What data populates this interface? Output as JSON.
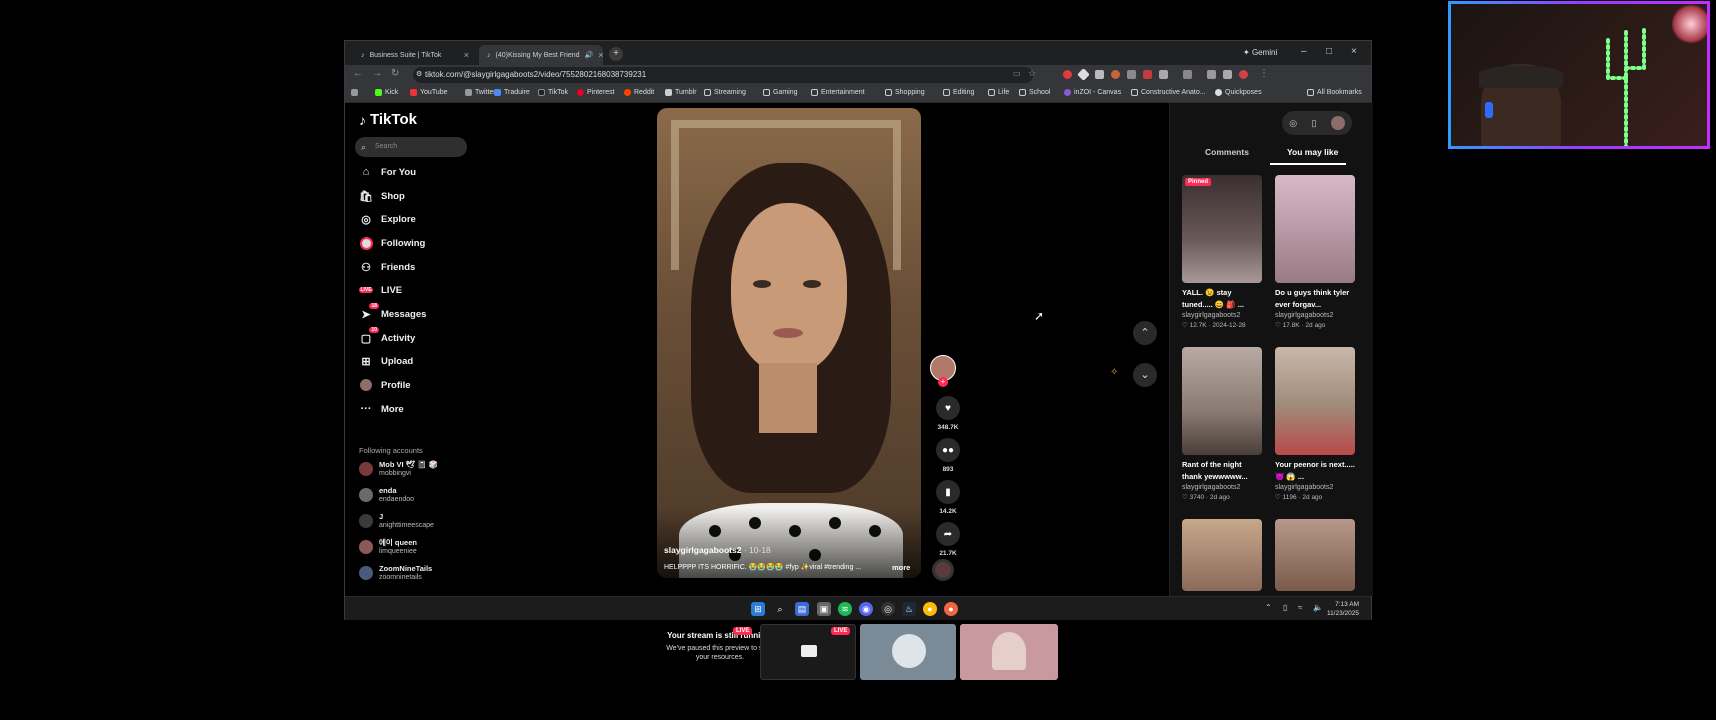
{
  "browser": {
    "tabs": [
      {
        "label": "Business Suite | TikTok",
        "active": false
      },
      {
        "label": "(40)Kissing My Best Friend",
        "active": true
      }
    ],
    "gemini_label": "Gemini",
    "url": "tiktok.com/@slaygirlgagaboots2/video/7552802168038739231",
    "bookmarks": [
      "Kick",
      "YouTube",
      "Twitter",
      "Traduire",
      "TikTok",
      "Pinterest",
      "Reddit",
      "Tumblr",
      "Streaming",
      "Gaming",
      "Entertainment",
      "Shopping",
      "Editing",
      "Life",
      "School",
      "inZOI - Canvas",
      "Constructive Anato...",
      "Quickposes"
    ],
    "all_bookmarks": "All Bookmarks"
  },
  "tiktok": {
    "logo": "TikTok",
    "search_placeholder": "Search",
    "nav": [
      {
        "label": "For You",
        "icon": "home-icon"
      },
      {
        "label": "Shop",
        "icon": "shop-icon"
      },
      {
        "label": "Explore",
        "icon": "explore-icon"
      },
      {
        "label": "Following",
        "icon": "following-icon"
      },
      {
        "label": "Friends",
        "icon": "friends-icon"
      },
      {
        "label": "LIVE",
        "icon": "live-icon"
      },
      {
        "label": "Messages",
        "icon": "messages-icon",
        "badge": "18"
      },
      {
        "label": "Activity",
        "icon": "activity-icon",
        "badge": "10"
      },
      {
        "label": "Upload",
        "icon": "upload-icon"
      },
      {
        "label": "Profile",
        "icon": "profile-icon"
      },
      {
        "label": "More",
        "icon": "more-icon"
      }
    ],
    "following_title": "Following accounts",
    "following": [
      {
        "name": "Mob VI 🕊 📓 🎲",
        "handle": "mobbingvi",
        "color": "#7a3a3a"
      },
      {
        "name": "enda",
        "handle": "endaendoo",
        "color": "#6a6a6a"
      },
      {
        "name": "J",
        "handle": "anighttimeescape",
        "color": "#3a3a3a"
      },
      {
        "name": "에이 queen",
        "handle": "limqueeniee",
        "color": "#8a5a5a"
      },
      {
        "name": "ZoomNineTails",
        "handle": "zoomninetails",
        "color": "#4a5a7a"
      }
    ],
    "video": {
      "username": "slaygirlgagaboots2",
      "date": "· 10-18",
      "caption": "HELPPPP ITS HORRIFIC. 😭😭😭😭 #fyp ✨viral #trending ...",
      "more": "more"
    },
    "actions": {
      "likes": "348.7K",
      "comments": "893",
      "saves": "14.2K",
      "shares": "21.7K"
    },
    "panel": {
      "tabs": [
        "Comments",
        "You may like"
      ],
      "selected_tab": "You may like",
      "cards": [
        {
          "title": "YALL. 😉 stay tuned..... 😄 🎒 ...",
          "user": "slaygirlgagaboots2",
          "likes": "12.7K",
          "date": "2024-12-28",
          "pinned": "Pinned",
          "bg": "#6a5a5a"
        },
        {
          "title": "Do u guys think tyler ever forgav...",
          "user": "slaygirlgagaboots2",
          "likes": "17.8K",
          "date": "2d ago",
          "pinned": "",
          "bg": "#b89aa8"
        },
        {
          "title": "Rant of the night thank yewwwww...",
          "user": "slaygirlgagaboots2",
          "likes": "3740",
          "date": "2d ago",
          "pinned": "",
          "bg": "#8a7a72"
        },
        {
          "title": "Your peenor is next..... 😈 😱 ...",
          "user": "slaygirlgagaboots2",
          "likes": "1196",
          "date": "2d ago",
          "pinned": "",
          "bg": "#a08a7a"
        },
        {
          "title": "",
          "user": "",
          "likes": "",
          "date": "",
          "pinned": "",
          "bg": "#8a6a5a"
        },
        {
          "title": "",
          "user": "",
          "likes": "",
          "date": "",
          "pinned": "",
          "bg": "#7a5a4a"
        }
      ]
    }
  },
  "taskbar": {
    "time": "7:13 AM",
    "date": "11/23/2025"
  },
  "stream": {
    "title": "Your stream is still running!",
    "live_badge": "LIVE",
    "subtitle": "We've paused this preview to save your resources."
  }
}
